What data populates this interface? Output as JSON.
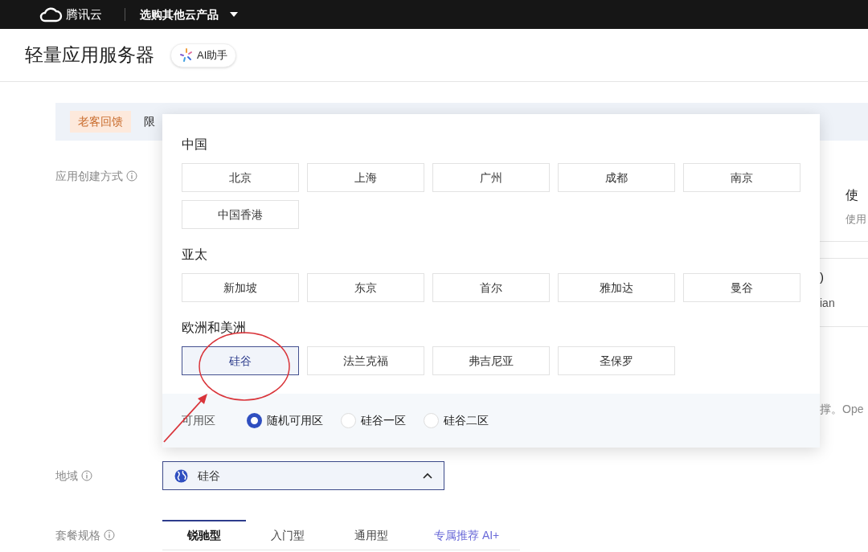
{
  "topbar": {
    "brand": "腾讯云",
    "product_menu": "选购其他云产品"
  },
  "page_title": "轻量应用服务器",
  "ai_button": "AI助手",
  "banner": {
    "tag": "老客回馈",
    "text": "限"
  },
  "form_labels": [
    "应用创建方式",
    "地域",
    "套餐规格"
  ],
  "side_fragments": {
    "card_1_title": "使",
    "card_1_text": "使用",
    "card_2_title": ")",
    "card_2_text": "ian",
    "note": "撑。Ope"
  },
  "region_popover": {
    "groups": [
      {
        "title": "中国",
        "regions": [
          {
            "label": "北京",
            "selected": false
          },
          {
            "label": "上海",
            "selected": false
          },
          {
            "label": "广州",
            "selected": false
          },
          {
            "label": "成都",
            "selected": false
          },
          {
            "label": "南京",
            "selected": false
          },
          {
            "label": "中国香港",
            "selected": false
          }
        ]
      },
      {
        "title": "亚太",
        "regions": [
          {
            "label": "新加坡",
            "selected": false
          },
          {
            "label": "东京",
            "selected": false
          },
          {
            "label": "首尔",
            "selected": false
          },
          {
            "label": "雅加达",
            "selected": false
          },
          {
            "label": "曼谷",
            "selected": false
          }
        ]
      },
      {
        "title": "欧洲和美洲",
        "regions": [
          {
            "label": "硅谷",
            "selected": true
          },
          {
            "label": "法兰克福",
            "selected": false
          },
          {
            "label": "弗吉尼亚",
            "selected": false
          },
          {
            "label": "圣保罗",
            "selected": false
          }
        ]
      }
    ],
    "zone": {
      "label": "可用区",
      "options": [
        {
          "label": "随机可用区",
          "selected": true
        },
        {
          "label": "硅谷一区",
          "selected": false
        },
        {
          "label": "硅谷二区",
          "selected": false
        }
      ]
    }
  },
  "region_select": {
    "value": "硅谷",
    "expanded": true
  },
  "plan_tabs": [
    {
      "label": "锐驰型",
      "selected": true,
      "kind": "tab"
    },
    {
      "label": "入门型",
      "selected": false,
      "kind": "tab"
    },
    {
      "label": "通用型",
      "selected": false,
      "kind": "tab"
    },
    {
      "label": "专属推荐 AI+",
      "selected": false,
      "kind": "recommend"
    }
  ]
}
